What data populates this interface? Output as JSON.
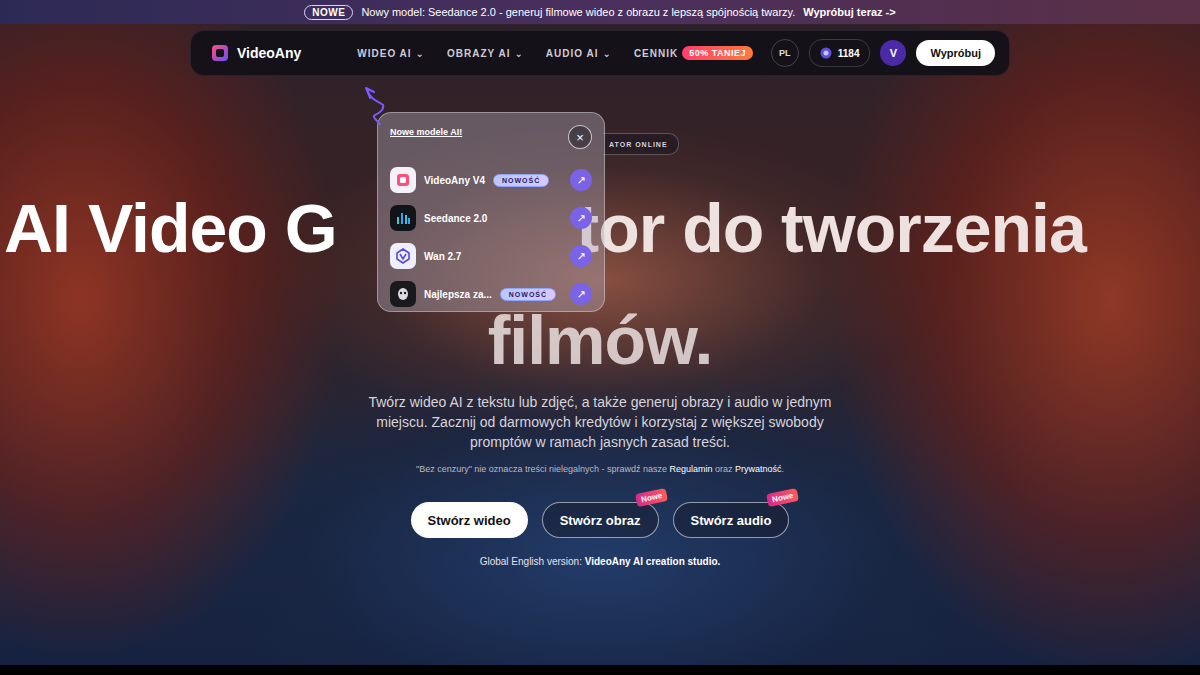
{
  "banner": {
    "badge": "NOWE",
    "text": "Nowy model: Seedance 2.0 - generuj filmowe wideo z obrazu z lepszą spójnością twarzy.",
    "link": "Wypróbuj teraz ->"
  },
  "nav": {
    "brand": "VideoAny",
    "menu": [
      {
        "label": "WIDEO AI",
        "caret": "⌄"
      },
      {
        "label": "OBRAZY AI",
        "caret": "⌄"
      },
      {
        "label": "AUDIO AI",
        "caret": "⌄"
      },
      {
        "label": "CENNIK",
        "caret": ""
      }
    ],
    "sale_badge": "50% TANIEJ",
    "language": "PL",
    "credits": "1184",
    "avatar": "V",
    "cta": "Wypróbuj"
  },
  "popup": {
    "title": "Nowe modele AI!",
    "close": "×",
    "items": [
      {
        "name": "VideoAny V4",
        "badge": "NOWOŚĆ",
        "go": "↗"
      },
      {
        "name": "Seedance 2.0",
        "badge": "",
        "go": "↗"
      },
      {
        "name": "Wan 2.7",
        "badge": "",
        "go": "↗"
      },
      {
        "name": "Najlepsza za...",
        "badge": "NOWOŚĆ",
        "go": "↗"
      }
    ]
  },
  "hero": {
    "pill": "ATOR ONLINE",
    "headline_left": "AI Video G",
    "headline_right": "tor do tworzenia",
    "headline_line2": "filmów.",
    "subtitle": "Twórz wideo AI z tekstu lub zdjęć, a także generuj obrazy i audio w jednym miejscu. Zacznij od darmowych kredytów i korzystaj z większej swobody promptów w ramach jasnych zasad treści.",
    "disclaimer": [
      "\"Bez cenzury\" nie oznacza treści nielegalnych - sprawdź nasze ",
      "Regulamin",
      " oraz ",
      "Prywatność",
      "."
    ],
    "buttons": [
      {
        "label": "Stwórz wideo",
        "kind": "primary",
        "badge": ""
      },
      {
        "label": "Stwórz obraz",
        "kind": "outline",
        "badge": "Nowe"
      },
      {
        "label": "Stwórz audio",
        "kind": "outline",
        "badge": "Nowe"
      }
    ],
    "global_prefix": "Global English version: ",
    "global_link": "VideoAny AI creation studio."
  }
}
